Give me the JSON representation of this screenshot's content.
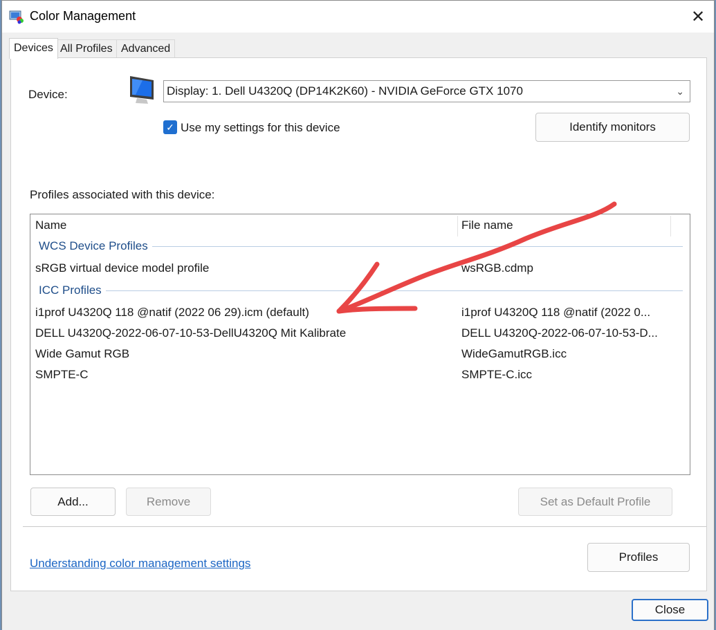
{
  "window": {
    "title": "Color Management"
  },
  "tabs": [
    {
      "label": "Devices"
    },
    {
      "label": "All Profiles"
    },
    {
      "label": "Advanced"
    }
  ],
  "device": {
    "label": "Device:",
    "selected": "Display: 1. Dell U4320Q (DP14K2K60) - NVIDIA GeForce GTX 1070",
    "use_settings_label": "Use my settings for this device",
    "use_settings_checked": true,
    "identify_button": "Identify monitors"
  },
  "profiles": {
    "section_label": "Profiles associated with this device:",
    "columns": {
      "name": "Name",
      "file": "File name"
    },
    "groups": [
      {
        "label": "WCS Device Profiles",
        "rows": [
          {
            "name": "sRGB virtual device model profile",
            "file": "wsRGB.cdmp"
          }
        ]
      },
      {
        "label": "ICC Profiles",
        "rows": [
          {
            "name": "i1prof U4320Q 118 @natif (2022 06 29).icm (default)",
            "file": "i1prof U4320Q 118 @natif (2022 0..."
          },
          {
            "name": "DELL U4320Q-2022-06-07-10-53-DellU4320Q Mit Kalibrate",
            "file": "DELL U4320Q-2022-06-07-10-53-D..."
          },
          {
            "name": "Wide Gamut RGB",
            "file": "WideGamutRGB.icc"
          },
          {
            "name": "SMPTE-C",
            "file": "SMPTE-C.icc"
          }
        ]
      }
    ]
  },
  "buttons": {
    "add": "Add...",
    "remove": "Remove",
    "set_default": "Set as Default Profile",
    "profiles": "Profiles",
    "close": "Close"
  },
  "link": "Understanding color management settings",
  "colors": {
    "accent": "#1f6fd0",
    "link": "#1c66c4",
    "annotation": "#e84545"
  }
}
